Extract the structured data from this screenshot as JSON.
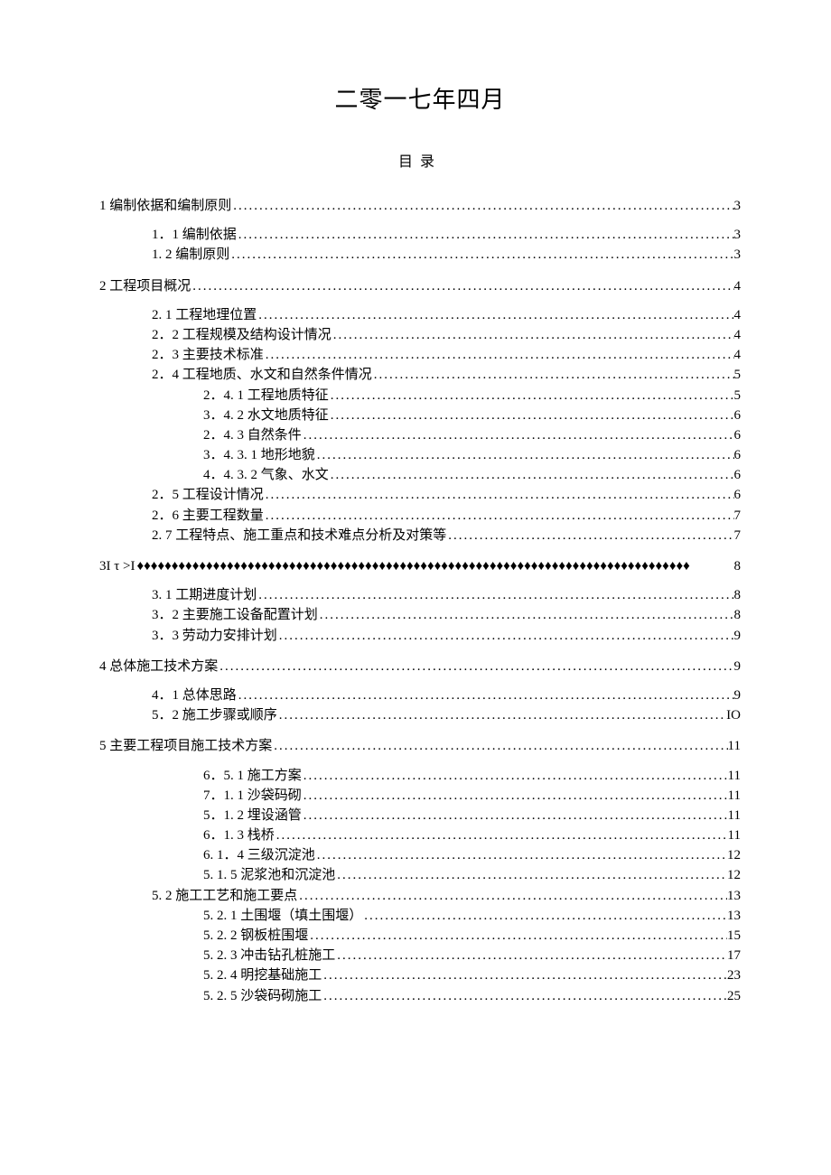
{
  "title": "二零一七年四月",
  "subtitle": "目录",
  "toc": [
    {
      "level": 0,
      "label": "1 编制依据和编制原则",
      "page": "3"
    },
    {
      "level": 1,
      "label": "1．1 编制依据",
      "page": "3"
    },
    {
      "level": 1,
      "label": "1. 2 编制原则",
      "page": "3"
    },
    {
      "level": 0,
      "label": "2 工程项目概况",
      "page": "4"
    },
    {
      "level": 1,
      "label": "2. 1 工程地理位置",
      "page": "4"
    },
    {
      "level": 1,
      "label": "2．2 工程规模及结构设计情况",
      "page": "4"
    },
    {
      "level": 1,
      "label": "2．3 主要技术标准",
      "page": "4"
    },
    {
      "level": 1,
      "label": "2．4 工程地质、水文和自然条件情况",
      "page": "5"
    },
    {
      "level": 2,
      "label": "2．4. 1 工程地质特征",
      "page": "5"
    },
    {
      "level": 2,
      "label": "3．4. 2 水文地质特征",
      "page": "6"
    },
    {
      "level": 2,
      "label": "2．4. 3 自然条件",
      "page": "6"
    },
    {
      "level": 2,
      "label": "3．4. 3. 1 地形地貌",
      "page": "6"
    },
    {
      "level": 2,
      "label": "4．4. 3. 2 气象、水文",
      "page": "6"
    },
    {
      "level": 1,
      "label": "2．5 工程设计情况",
      "page": "6"
    },
    {
      "level": 1,
      "label": "2．6 主要工程数量",
      "page": "7"
    },
    {
      "level": 1,
      "label": "2. 7 工程特点、施工重点和技术难点分析及对策等",
      "page": "7"
    },
    {
      "level": 0,
      "label": "3Ι τ >I",
      "page": "8",
      "diamonds": true
    },
    {
      "level": 1,
      "label": "3. 1 工期进度计划",
      "page": "8"
    },
    {
      "level": 1,
      "label": "3．2 主要施工设备配置计划",
      "page": "8"
    },
    {
      "level": 1,
      "label": "3．3 劳动力安排计划",
      "page": "9"
    },
    {
      "level": 0,
      "label": "4 总体施工技术方案",
      "page": "9"
    },
    {
      "level": 1,
      "label": "4．1 总体思路",
      "page": "9"
    },
    {
      "level": 1,
      "label": "5．2 施工步骤或顺序",
      "page": "IO"
    },
    {
      "level": 0,
      "label": "5 主要工程项目施工技术方案",
      "page": "11"
    },
    {
      "level": 2,
      "label": "6．5. 1 施工方案",
      "page": "11"
    },
    {
      "level": 2,
      "label": "7．1. 1 沙袋码砌",
      "page": "11"
    },
    {
      "level": 2,
      "label": "5．1. 2 埋设涵管",
      "page": "11"
    },
    {
      "level": 2,
      "label": "6．1. 3 栈桥",
      "page": "11"
    },
    {
      "level": 2,
      "label": "6. 1．4 三级沉淀池",
      "page": "12"
    },
    {
      "level": 2,
      "label": "5. 1. 5 泥浆池和沉淀池",
      "page": "12"
    },
    {
      "level": 1,
      "label": "5. 2 施工工艺和施工要点",
      "page": "13"
    },
    {
      "level": 2,
      "label": "5. 2. 1 土围堰（填土围堰）",
      "page": "13"
    },
    {
      "level": 2,
      "label": "5. 2. 2 钢板桩围堰",
      "page": "15"
    },
    {
      "level": 2,
      "label": "5. 2. 3 冲击钻孔桩施工",
      "page": "17"
    },
    {
      "level": 2,
      "label": "5. 2. 4 明挖基础施工",
      "page": "23"
    },
    {
      "level": 2,
      "label": "5. 2. 5 沙袋码砌施工",
      "page": "25"
    }
  ]
}
